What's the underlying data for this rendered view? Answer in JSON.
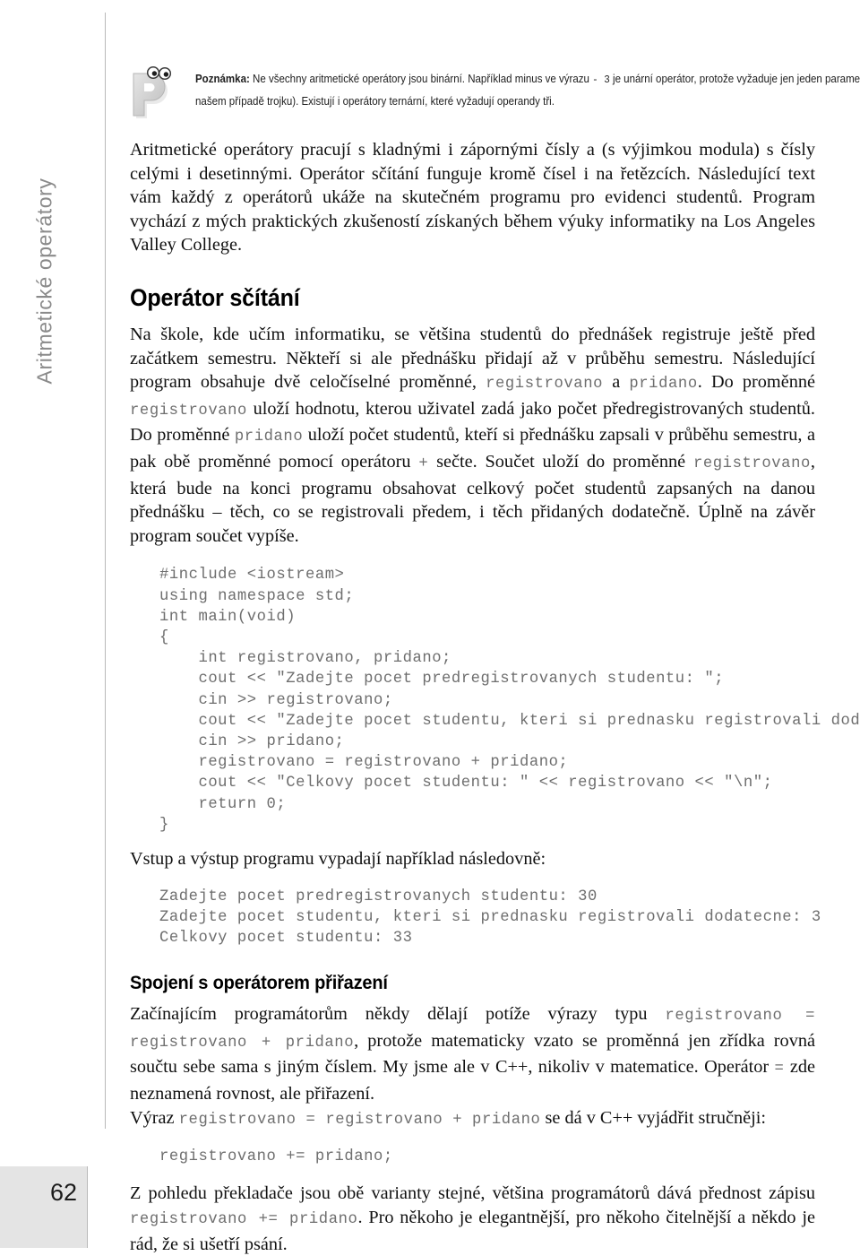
{
  "running_head": "Aritmetické operátory",
  "page_number": "62",
  "note": {
    "icon": "note-p-character-icon",
    "label": "Poznámka:",
    "line1_a": " Ne všechny aritmetické operátory jsou binární. Například minus ve výrazu ",
    "line1_code": "- 3",
    "line1_b": " je unární operátor, protože vyžaduje jen jeden parametr (v našem případě trojku). Existují i operátory ternární, které vyžadují operandy tři."
  },
  "intro": {
    "text": "Aritmetické operátory pracují s kladnými i zápornými čísly a (s výjimkou modula) s čísly celými i desetinnými. Operátor sčítání funguje kromě čísel i na řetězcích. Následující text vám každý z operátorů ukáže na skutečném programu pro evidenci studentů. Program vychází z mých praktických zkušeností získaných během výuky informatiky na Los Angeles Valley College."
  },
  "section1": {
    "heading": "Operátor sčítání",
    "p1_a": "Na škole, kde učím informatiku, se většina studentů do přednášek registruje ještě před začátkem semestru. Někteří si ale přednášku přidají až v průběhu semestru. Následující program obsahuje dvě celočíselné proměnné, ",
    "code_registrovano": "registrovano",
    "p1_b": " a ",
    "code_pridano": "pridano",
    "p1_c": ". Do proměnné ",
    "p1_d": " uloží hodnotu, kterou uživatel zadá jako počet předregistrovaných studentů. Do proměnné ",
    "p1_e": " uloží počet studentů, kteří si přednášku zapsali v průběhu semestru, a pak obě proměnné pomocí operátoru ",
    "code_plus": "+",
    "p1_f": " sečte. Součet uloží do proměnné ",
    "p1_g": ", která bude na konci programu obsahovat celkový počet studentů zapsaných na danou přednášku – těch, co se registrovali předem, i těch přidaných dodatečně. Úplně na závěr program součet vypíše.",
    "code": "#include <iostream>\nusing namespace std;\nint main(void)\n{\n    int registrovano, pridano;\n    cout << \"Zadejte pocet predregistrovanych studentu: \";\n    cin >> registrovano;\n    cout << \"Zadejte pocet studentu, kteri si prednasku registrovali dodatecne: \";\n    cin >> pridano;\n    registrovano = registrovano + pridano;\n    cout << \"Celkovy pocet studentu: \" << registrovano << \"\\n\";\n    return 0;\n}",
    "p2": "Vstup a výstup programu vypadají například následovně:",
    "output": "Zadejte pocet predregistrovanych studentu: 30\nZadejte pocet studentu, kteri si prednasku registrovali dodatecne: 3\nCelkovy pocet studentu: 33"
  },
  "section2": {
    "heading": "Spojení s operátorem přiřazení",
    "p1_a": "Začínajícím programátorům někdy dělají potíže výrazy typu ",
    "p1_code1": "registrovano = registrovano + pridano",
    "p1_b": ", protože matematicky vzato se proměnná jen zřídka rovná součtu sebe sama s jiným číslem. My jsme ale v C++, nikoliv v matematice. Operátor ",
    "p1_code2": "=",
    "p1_c": " zde neznamená rovnost, ale přiřazení.",
    "p2_a": "Výraz ",
    "p2_code": "registrovano = registrovano + pridano",
    "p2_b": " se dá v C++ vyjádřit stručněji:",
    "snippet": "registrovano += pridano;",
    "p3_a": "Z pohledu překladače jsou obě varianty stejné, většina programátorů dává přednost zápisu ",
    "p3_code": "registrovano += pridano",
    "p3_b": ". Pro někoho je elegantnější, pro někoho čitelnější a někdo je rád, že si ušetří psání."
  },
  "colors": {
    "rule": "#b9b9b9",
    "running_head_text": "#8a8a8a",
    "code_text": "#6e6e6e",
    "page_number_bg": "#e4e4e4",
    "note_icon": "#cfcfcf"
  }
}
